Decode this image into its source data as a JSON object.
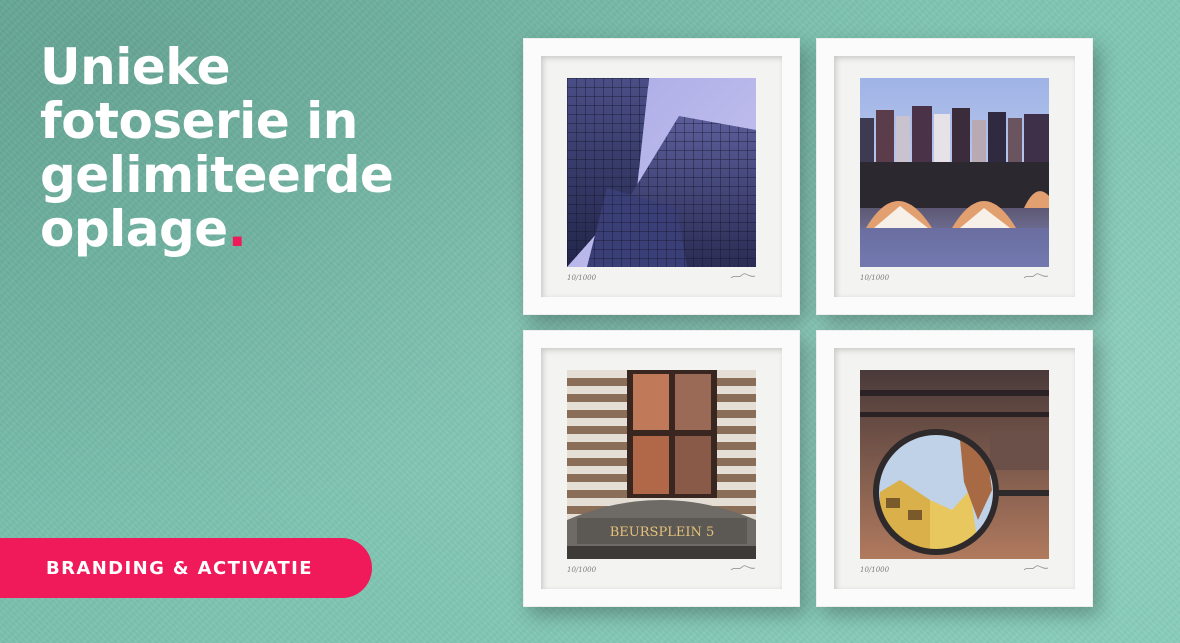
{
  "headline": {
    "lines": [
      "Unieke",
      "fotoserie in",
      "gelimiteerde",
      "oplage"
    ],
    "dot": "."
  },
  "category": {
    "label": "BRANDING & ACTIVATIE"
  },
  "colors": {
    "accent": "#f0195a",
    "wall": "#7ec4b1",
    "frame": "#fbfbfb"
  },
  "frames": [
    {
      "subject": "glass-skyscrapers-photo",
      "edition": "10/1000"
    },
    {
      "subject": "canal-bridge-photo",
      "edition": "10/1000"
    },
    {
      "subject": "beursplein-facade-photo",
      "edition": "10/1000",
      "sign": "BEURSPLEIN 5"
    },
    {
      "subject": "mirror-reflection-photo",
      "edition": "10/1000"
    }
  ]
}
